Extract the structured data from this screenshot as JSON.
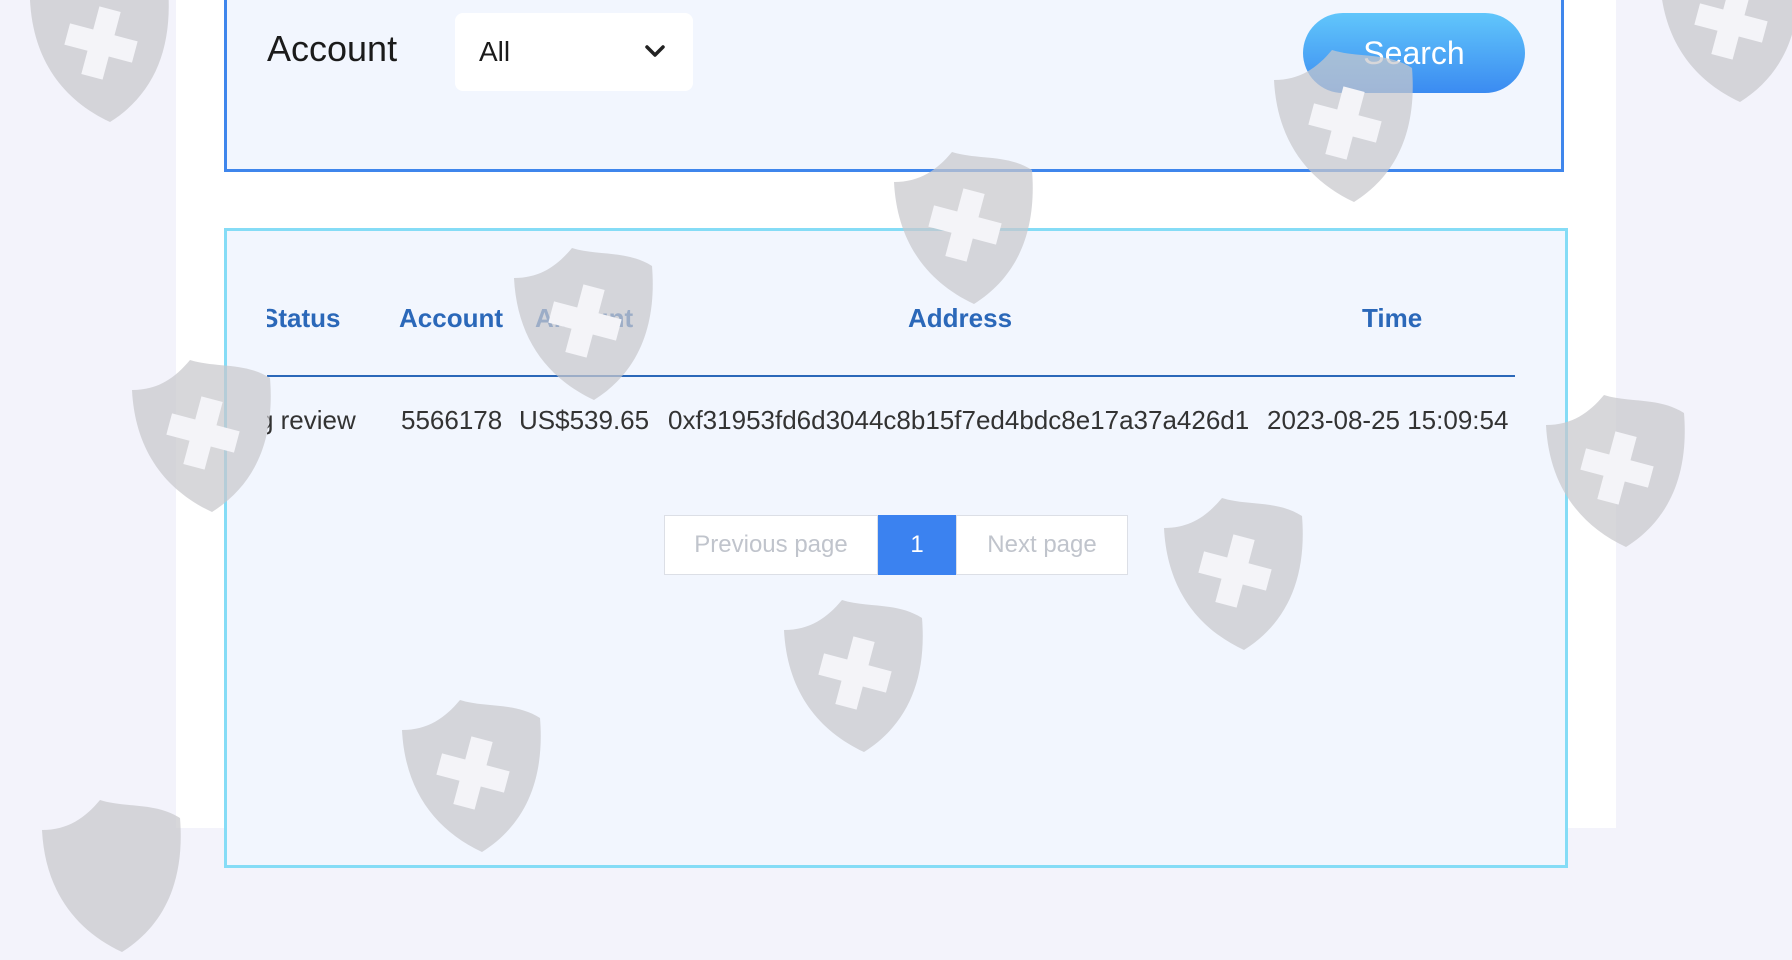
{
  "filter": {
    "account_label": "Account",
    "select_value": "All",
    "search_label": "Search"
  },
  "table": {
    "headers": {
      "status": "Status",
      "account": "Account",
      "amount": "Amount",
      "address": "Address",
      "time": "Time"
    },
    "rows": [
      {
        "status": "Pending review",
        "account": "5566178",
        "amount": "US$539.65",
        "address": "0xf31953fd6d3044c8b15f7ed4bdc8e17a37a426d1",
        "time": "2023-08-25 15:09:54"
      }
    ]
  },
  "pagination": {
    "prev_label": "Previous page",
    "current_page": "1",
    "next_label": "Next page"
  },
  "colors": {
    "accent": "#3b82f0",
    "header_text": "#2b68b9",
    "filter_border": "#3f86ec",
    "table_border": "#85dcf6"
  },
  "icons": {
    "select": "chevron-down-icon",
    "watermark": "shield-cross-icon"
  }
}
